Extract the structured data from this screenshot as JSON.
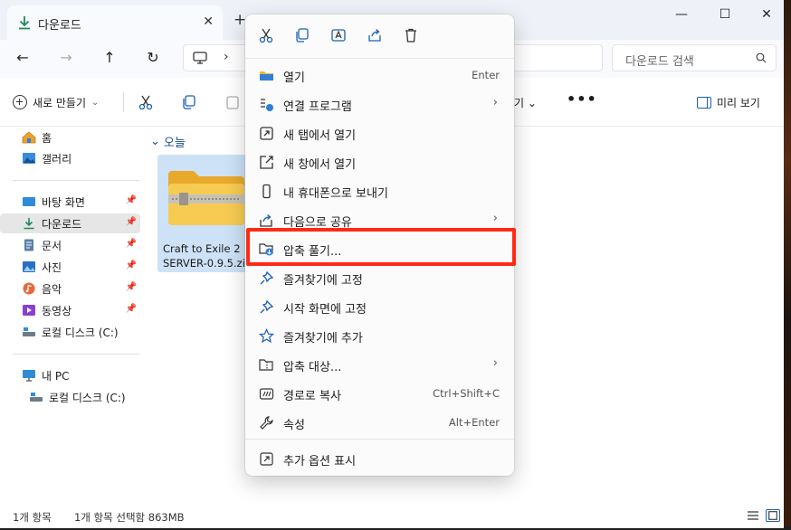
{
  "window": {
    "tab_title": "다운로드",
    "tab_close": "✕",
    "new_tab": "+",
    "minimize": "—",
    "maximize": "☐",
    "close": "✕"
  },
  "nav": {
    "back": "←",
    "forward": "→",
    "up": "↑",
    "refresh": "↻",
    "address_chevron": "›",
    "search_placeholder": "다운로드 검색"
  },
  "commandbar": {
    "new_label": "새로 만들기",
    "new_chevron": "⌄",
    "sort_label": "기 ⌄",
    "more": "•••",
    "preview_label": "미리 보기"
  },
  "sidebar": {
    "items": [
      {
        "label": "홈",
        "icon": "home-icon",
        "pinned": false
      },
      {
        "label": "갤러리",
        "icon": "gallery-icon",
        "pinned": false
      },
      {
        "label": "바탕 화면",
        "icon": "desktop-icon",
        "pinned": true
      },
      {
        "label": "다운로드",
        "icon": "download-icon",
        "pinned": true,
        "active": true
      },
      {
        "label": "문서",
        "icon": "documents-icon",
        "pinned": true
      },
      {
        "label": "사진",
        "icon": "pictures-icon",
        "pinned": true
      },
      {
        "label": "음악",
        "icon": "music-icon",
        "pinned": true
      },
      {
        "label": "동영상",
        "icon": "videos-icon",
        "pinned": true
      },
      {
        "label": "로컬 디스크 (C:)",
        "icon": "drive-icon",
        "pinned": false
      },
      {
        "label": "내 PC",
        "icon": "this-pc-icon",
        "pinned": false
      },
      {
        "label": "로컬 디스크 (C:)",
        "icon": "drive-icon",
        "pinned": false
      }
    ],
    "pin_glyph": "📌"
  },
  "content": {
    "group_chevron": "⌄",
    "group_label": "오늘",
    "file_name_line1": "Craft to Exile 2",
    "file_name_line2": "SERVER-0.9.5.zip"
  },
  "status": {
    "item_count": "1개 항목",
    "selection": "1개 항목 선택함 863MB"
  },
  "menu": {
    "top_icons": [
      "cut-icon",
      "copy-icon",
      "rename-icon",
      "share-icon",
      "delete-icon"
    ],
    "items": [
      {
        "label": "열기",
        "shortcut": "Enter",
        "arrow": "",
        "icon": "folder-open-icon"
      },
      {
        "label": "연결 프로그램",
        "shortcut": "",
        "arrow": "›",
        "icon": "open-with-icon"
      },
      {
        "label": "새 탭에서 열기",
        "shortcut": "",
        "arrow": "",
        "icon": "new-tab-icon"
      },
      {
        "label": "새 창에서 열기",
        "shortcut": "",
        "arrow": "",
        "icon": "new-window-icon"
      },
      {
        "label": "내 휴대폰으로 보내기",
        "shortcut": "",
        "arrow": "",
        "icon": "phone-icon"
      },
      {
        "label": "다음으로 공유",
        "shortcut": "",
        "arrow": "›",
        "icon": "share-icon"
      },
      {
        "label": "압축 풀기...",
        "shortcut": "",
        "arrow": "",
        "icon": "extract-icon"
      },
      {
        "label": "즐겨찾기에 고정",
        "shortcut": "",
        "arrow": "",
        "icon": "pin-icon"
      },
      {
        "label": "시작 화면에 고정",
        "shortcut": "",
        "arrow": "",
        "icon": "pin-start-icon"
      },
      {
        "label": "즐겨찾기에 추가",
        "shortcut": "",
        "arrow": "",
        "icon": "star-icon"
      },
      {
        "label": "압축 대상...",
        "shortcut": "",
        "arrow": "›",
        "icon": "compress-icon"
      },
      {
        "label": "경로로 복사",
        "shortcut": "Ctrl+Shift+C",
        "arrow": "",
        "icon": "copy-path-icon"
      },
      {
        "label": "속성",
        "shortcut": "Alt+Enter",
        "arrow": "",
        "icon": "properties-icon"
      },
      {
        "label": "추가 옵션 표시",
        "shortcut": "",
        "arrow": "",
        "icon": "more-options-icon"
      }
    ]
  },
  "colors": {
    "highlight": "#ff2a14",
    "accent": "#1a5fb4",
    "download_green": "#1f8a5b",
    "folder_yellow": "#f4c542"
  }
}
